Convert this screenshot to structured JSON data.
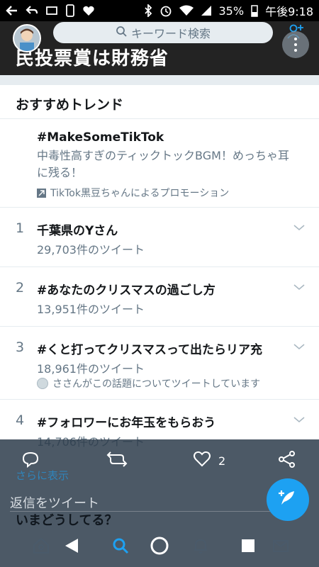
{
  "status_bar": {
    "battery": "35%",
    "time": "午後9:18"
  },
  "header": {
    "search_placeholder": "キーワード検索",
    "hero_text": "民投票賞は財務省"
  },
  "trends": {
    "section_title": "おすすめトレンド",
    "promoted": {
      "tag": "#MakeSomeTikTok",
      "description": "中毒性高すぎのティックトックBGM！めっちゃ耳に残る！",
      "promoted_by": "TikTok黒豆ちゃんによるプロモーション"
    },
    "items": [
      {
        "rank": "1",
        "name": "千葉県のYさん",
        "count": "29,703件のツイート"
      },
      {
        "rank": "2",
        "name": "#あなたのクリスマスの過ごし方",
        "count": "13,951件のツイート"
      },
      {
        "rank": "3",
        "name": "#くと打ってクリスマスって出たらリア充",
        "count": "18,961件のツイート",
        "social": "ささんがこの話題についてツイートしています"
      },
      {
        "rank": "4",
        "name": "#フォロワーにお年玉をもらおう",
        "count": "14,706件のツイート"
      }
    ],
    "show_more": "さらに表示"
  },
  "actions": {
    "like_count": "2"
  },
  "composer": {
    "reply_placeholder": "返信をツイート",
    "prompt": "いまどうしてる？"
  },
  "colors": {
    "accent": "#1da1f2",
    "text_primary": "#14171a",
    "text_secondary": "#657786",
    "divider": "#e6ecf0"
  }
}
